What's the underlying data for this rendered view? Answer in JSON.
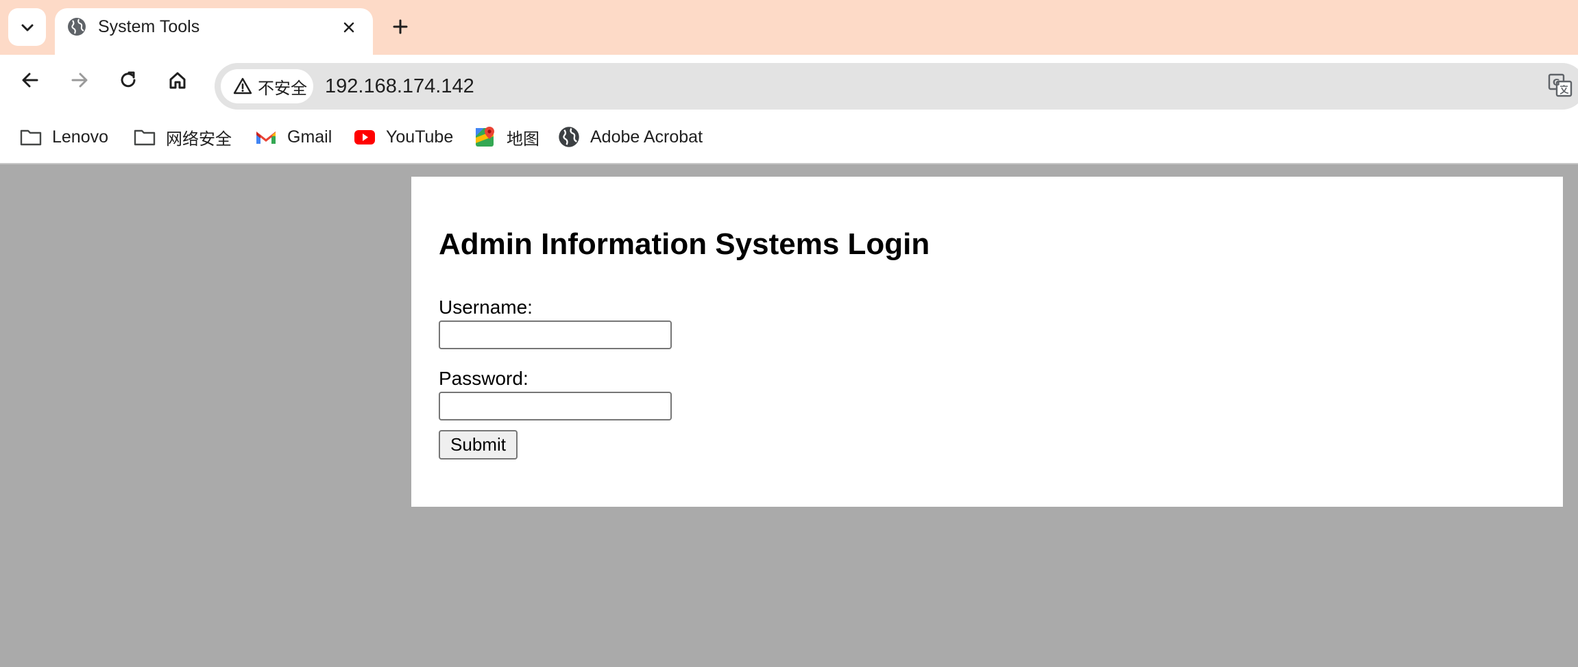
{
  "tabstrip": {
    "search_tabs_icon": "chevron-down-icon",
    "active_tab": {
      "title": "System Tools",
      "favicon": "globe-icon",
      "close_icon": "close-icon"
    },
    "new_tab_icon": "plus-icon",
    "background_color": "#fddac7"
  },
  "toolbar": {
    "back_icon": "arrow-left-icon",
    "forward_icon": "arrow-right-icon",
    "reload_icon": "reload-icon",
    "home_icon": "home-icon",
    "security_label": "不安全",
    "security_icon": "warning-icon",
    "url": "192.168.174.142",
    "translate_icon": "translate-icon"
  },
  "bookmarks": [
    {
      "label": "Lenovo",
      "icon": "folder-icon"
    },
    {
      "label": "网络安全",
      "icon": "folder-icon"
    },
    {
      "label": "Gmail",
      "icon": "gmail-icon"
    },
    {
      "label": "YouTube",
      "icon": "youtube-icon"
    },
    {
      "label": "地图",
      "icon": "maps-icon"
    },
    {
      "label": "Adobe Acrobat",
      "icon": "globe-icon"
    }
  ],
  "page": {
    "background_color": "#aaaaaa",
    "title": "Admin Information Systems Login",
    "username_label": "Username:",
    "username_value": "",
    "password_label": "Password:",
    "password_value": "",
    "submit_label": "Submit"
  }
}
